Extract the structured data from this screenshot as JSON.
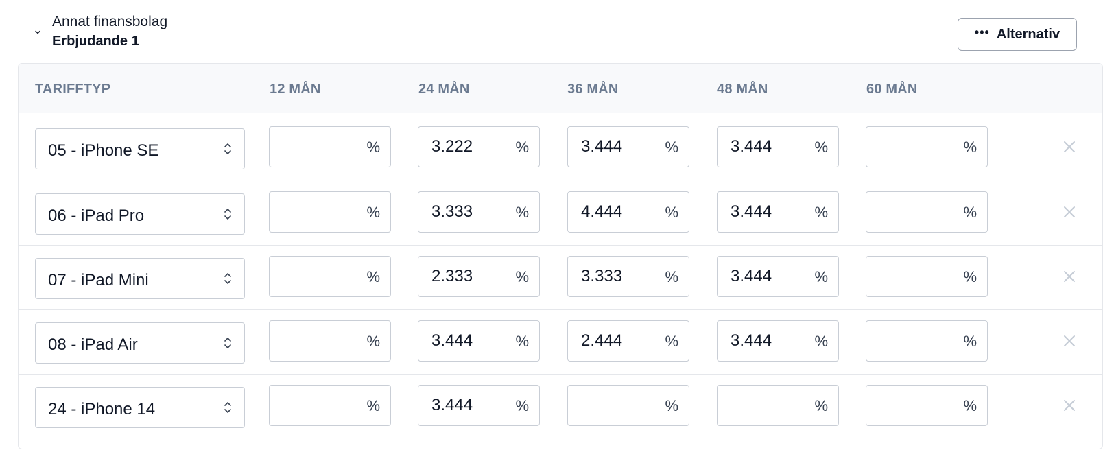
{
  "header": {
    "lender_name": "Annat finansbolag",
    "offer_title": "Erbjudande 1",
    "options_label": "Alternativ",
    "toggle_icon": "chevron-down-icon",
    "options_icon": "ellipsis-icon"
  },
  "table": {
    "columns": [
      "TARIFFTYP",
      "12 MÅN",
      "24 MÅN",
      "36 MÅN",
      "48 MÅN",
      "60 MÅN"
    ],
    "percent_symbol": "%",
    "rows": [
      {
        "tariff": "05 - iPhone SE",
        "rates": [
          "",
          "3.222",
          "3.444",
          "3.444",
          ""
        ]
      },
      {
        "tariff": "06 - iPad Pro",
        "rates": [
          "",
          "3.333",
          "4.444",
          "3.444",
          ""
        ]
      },
      {
        "tariff": "07 - iPad Mini",
        "rates": [
          "",
          "2.333",
          "3.333",
          "3.444",
          ""
        ]
      },
      {
        "tariff": "08 - iPad Air",
        "rates": [
          "",
          "3.444",
          "2.444",
          "3.444",
          ""
        ]
      },
      {
        "tariff": "24 - iPhone 14",
        "rates": [
          "",
          "3.444",
          "",
          "",
          ""
        ]
      }
    ]
  },
  "colors": {
    "header_bg": "#f8f9fb",
    "header_text": "#6b7a90",
    "border": "#c9ced6",
    "remove_icon": "#c5ccd6"
  }
}
